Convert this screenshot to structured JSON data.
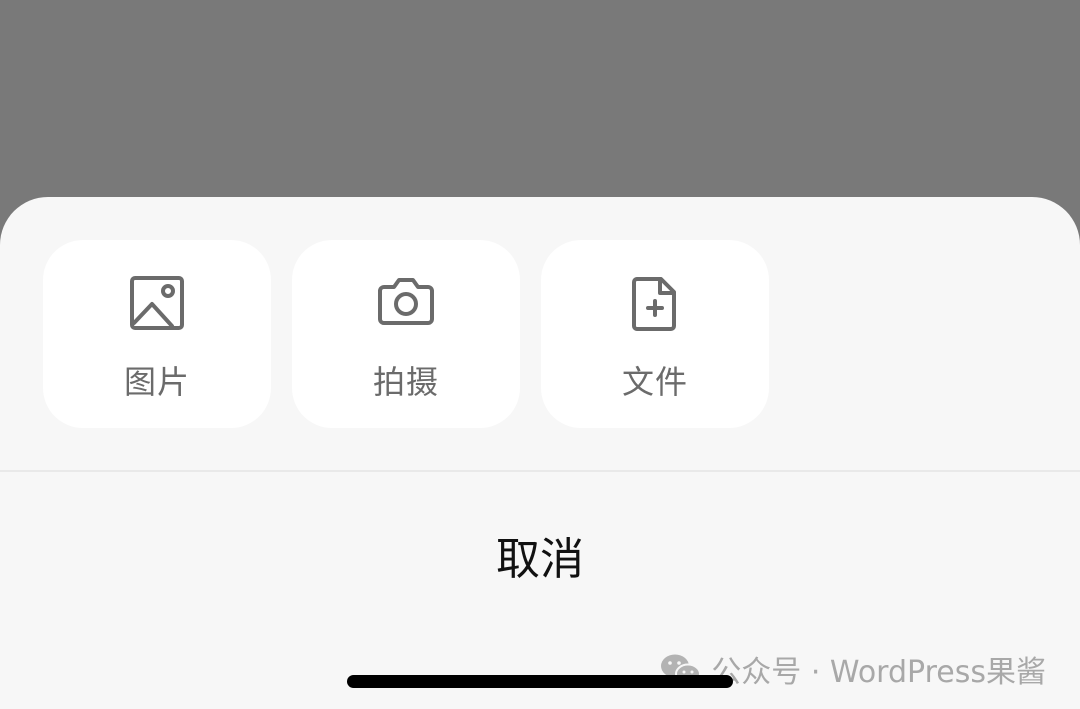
{
  "sheet": {
    "options": [
      {
        "label": "图片",
        "icon": "image-icon"
      },
      {
        "label": "拍摄",
        "icon": "camera-icon"
      },
      {
        "label": "文件",
        "icon": "file-add-icon"
      }
    ],
    "cancel_label": "取消"
  },
  "watermark": {
    "text": "公众号 · WordPress果酱",
    "icon": "wechat-icon"
  },
  "colors": {
    "overlay": "#797979",
    "sheet_bg": "#f7f7f7",
    "card_bg": "#ffffff",
    "icon_color": "#6b6b6b",
    "cancel_text": "#111111"
  }
}
